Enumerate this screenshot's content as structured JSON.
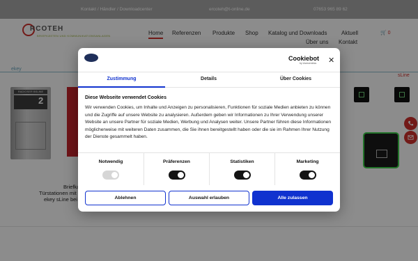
{
  "topbar": {
    "links": "Kontakt  /  Händler  /  Downloadcenter",
    "email": "ercoteh@t-online.de",
    "phone": "07653 965 89 62"
  },
  "logo": {
    "text": "RCOTEH",
    "tagline": "BRIEFKÄSTEN UND KOMMUNIKATIONSANLAGEN"
  },
  "nav": {
    "items": [
      "Home",
      "Referenzen",
      "Produkte",
      "Shop",
      "Katalog und Downloads",
      "Aktuell",
      "Über uns",
      "Kontakt"
    ],
    "cart_count": "0"
  },
  "page": {
    "left_label": "ekey",
    "right_label": "sLine",
    "caption_lines": [
      "Briefka",
      "Türstationen mit c",
      "ekey sLine bei"
    ],
    "panel_number": "2",
    "panel_brand": "RADIOSER BSLINE"
  },
  "cookie_dialog": {
    "brand": "Cookiebot",
    "brand_sub": "by Usercentrics",
    "tabs": [
      "Zustimmung",
      "Details",
      "Über Cookies"
    ],
    "active_tab": "Zustimmung",
    "title": "Diese Webseite verwendet Cookies",
    "text": "Wir verwenden Cookies, um Inhalte und Anzeigen zu personalisieren, Funktionen für soziale Medien anbieten zu können und die Zugriffe auf unsere Website zu analysieren. Außerdem geben wir Informationen zu Ihrer Verwendung unserer Website an unsere Partner für soziale Medien, Werbung und Analysen weiter. Unsere Partner führen diese Informationen möglicherweise mit weiteren Daten zusammen, die Sie ihnen bereitgestellt haben oder die sie im Rahmen Ihrer Nutzung der Dienste gesammelt haben.",
    "categories": [
      {
        "label": "Notwendig",
        "enabled": true,
        "locked": true
      },
      {
        "label": "Präferenzen",
        "enabled": true,
        "locked": false
      },
      {
        "label": "Statistiken",
        "enabled": true,
        "locked": false
      },
      {
        "label": "Marketing",
        "enabled": true,
        "locked": false
      }
    ],
    "buttons": {
      "reject": "Ablehnen",
      "selection": "Auswahl erlauben",
      "accept_all": "Alle zulassen"
    }
  },
  "colors": {
    "accent": "#1032cf",
    "brand_red": "#d0312d",
    "toggle_dark": "#141414",
    "toggle_locked": "#d6d6d6"
  }
}
